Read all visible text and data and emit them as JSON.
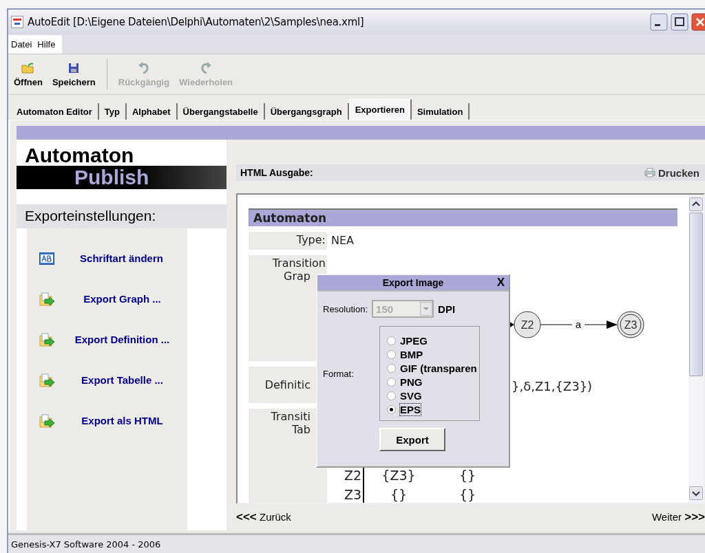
{
  "window": {
    "title": "AutoEdit [D:\\Eigene Dateien\\Delphi\\Automaten\\2\\Samples\\nea.xml]"
  },
  "menu": [
    "Datei",
    "Hilfe"
  ],
  "toolbar": [
    {
      "label": "Öffnen",
      "kind": "open",
      "disabled": false
    },
    {
      "label": "Speichern",
      "kind": "save",
      "disabled": false
    },
    {
      "label": "Rückgängig",
      "kind": "undo",
      "disabled": true
    },
    {
      "label": "Wiederholen",
      "kind": "redo",
      "disabled": true
    }
  ],
  "tabs": [
    {
      "label": "Automaton Editor",
      "selected": false
    },
    {
      "label": "Typ",
      "selected": false
    },
    {
      "label": "Alphabet",
      "selected": false
    },
    {
      "label": "Übergangstabelle",
      "selected": false
    },
    {
      "label": "Übergangsgraph",
      "selected": false
    },
    {
      "label": "Exportieren",
      "selected": true
    },
    {
      "label": "Simulation",
      "selected": false
    }
  ],
  "logo": {
    "line_1": "Automaton",
    "line_2": "Publish"
  },
  "sidebar": {
    "heading": "Exporteinstellungen:",
    "items": [
      {
        "label": "Schriftart ändern",
        "kind": "font"
      },
      {
        "label": "Export Graph ...",
        "kind": "export"
      },
      {
        "label": "Export Definition ...",
        "kind": "export"
      },
      {
        "label": "Export Tabelle ...",
        "kind": "export"
      },
      {
        "label": "Export als HTML",
        "kind": "export"
      }
    ]
  },
  "output": {
    "heading": "HTML Ausgabe:",
    "print_button": "Drucken",
    "section_title": "Automaton",
    "type_label": "Type:",
    "type_value": "NEA",
    "graph_label_1": "Transition",
    "graph_label_2": "Grap",
    "graph": {
      "nodes": [
        {
          "label": "Z2",
          "accepting": false
        },
        {
          "label": "Z3",
          "accepting": true
        }
      ],
      "edge_label": "a"
    },
    "definition_label": "Definitic",
    "definition_value": "},δ,Z1,{Z3})",
    "table_label_1": "Transiti",
    "table_label_2": "Tab",
    "table_rows": [
      {
        "state": "Z2",
        "cells": [
          "{Z3}",
          "{}"
        ]
      },
      {
        "state": "Z3",
        "cells": [
          "{}",
          "{}"
        ]
      }
    ]
  },
  "navigation": {
    "back": "<<<",
    "back_label": "Zurück",
    "next_label": "Weiter",
    "next": ">>>"
  },
  "dialog": {
    "title": "Export Image",
    "close": "X",
    "resolution_label": "Resolution:",
    "resolution_value": "150",
    "resolution_disabled": true,
    "unit": "DPI",
    "format_label": "Format:",
    "formats": [
      {
        "label": "JPEG",
        "selected": false
      },
      {
        "label": "BMP",
        "selected": false
      },
      {
        "label": "GIF (transparen",
        "selected": false
      },
      {
        "label": "PNG",
        "selected": false
      },
      {
        "label": "SVG",
        "selected": false
      },
      {
        "label": "EPS",
        "selected": true
      }
    ],
    "export_button": "Export"
  },
  "status_bar": "Genesis-X7 Software 2004 - 2006"
}
